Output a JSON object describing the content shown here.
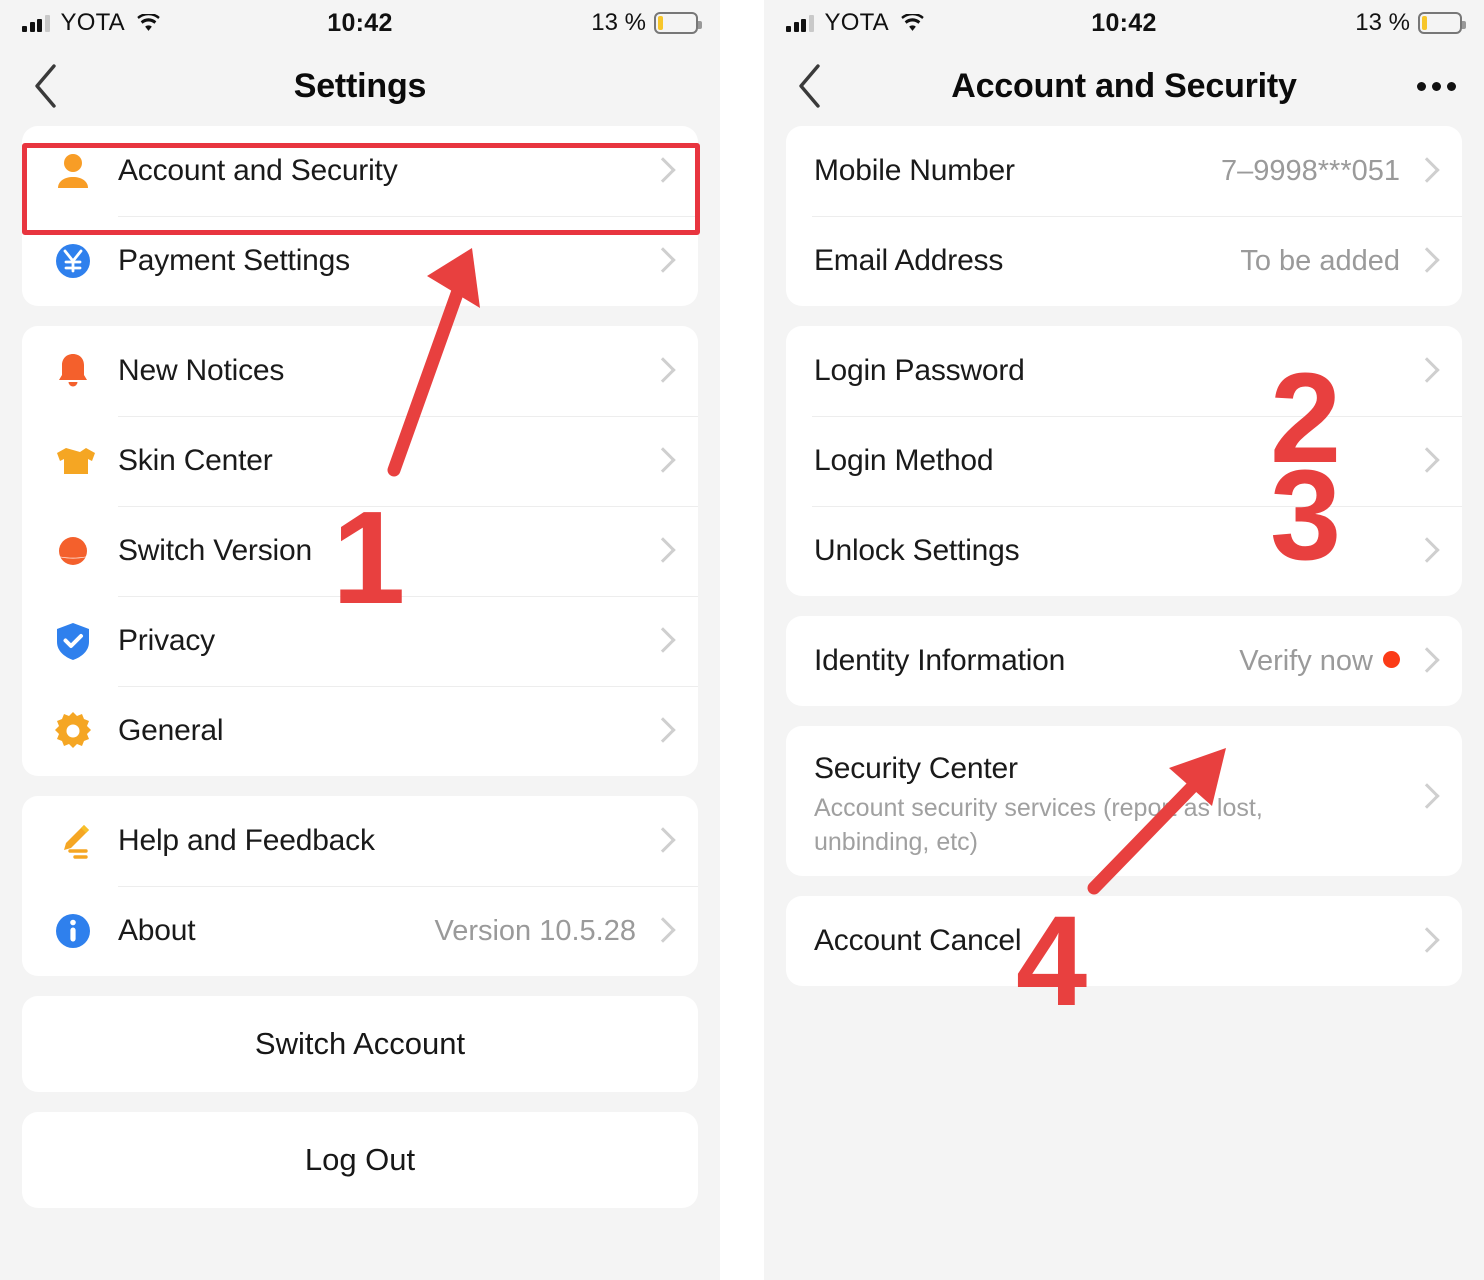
{
  "status_bar": {
    "carrier": "YOTA",
    "time": "10:42",
    "battery_percent": "13 %",
    "battery_level": 13,
    "signal_bars": 4,
    "signal_filled": 3,
    "wifi_icon": "wifi-icon",
    "battery_icon": "battery-icon"
  },
  "left_screen": {
    "nav": {
      "back_icon": "back-chevron-icon",
      "title": "Settings"
    },
    "groups": [
      {
        "items": [
          {
            "icon": "person-icon",
            "label": "Account and Security",
            "value": "",
            "chevron": true
          },
          {
            "icon": "payment-yen-icon",
            "label": "Payment Settings",
            "value": "",
            "chevron": true
          }
        ]
      },
      {
        "items": [
          {
            "icon": "bell-icon",
            "label": "New Notices",
            "value": "",
            "chevron": true
          },
          {
            "icon": "tshirt-icon",
            "label": "Skin Center",
            "value": "",
            "chevron": true
          },
          {
            "icon": "planet-icon",
            "label": "Switch Version",
            "value": "",
            "chevron": true
          },
          {
            "icon": "shield-check-icon",
            "label": "Privacy",
            "value": "",
            "chevron": true
          },
          {
            "icon": "gear-icon",
            "label": "General",
            "value": "",
            "chevron": true
          }
        ]
      },
      {
        "items": [
          {
            "icon": "pencil-icon",
            "label": "Help and Feedback",
            "value": "",
            "chevron": true
          },
          {
            "icon": "info-icon",
            "label": "About",
            "value": "Version 10.5.28",
            "chevron": true
          }
        ]
      }
    ],
    "buttons": [
      {
        "label": "Switch Account"
      },
      {
        "label": "Log Out"
      }
    ]
  },
  "right_screen": {
    "nav": {
      "back_icon": "back-chevron-icon",
      "title": "Account and Security",
      "more_icon": "more-dots-icon"
    },
    "groups": [
      {
        "items": [
          {
            "label": "Mobile Number",
            "value": "7–9998***051",
            "sub": "",
            "dot": false,
            "chevron": true
          },
          {
            "label": "Email Address",
            "value": "To be added",
            "sub": "",
            "dot": false,
            "chevron": true
          }
        ]
      },
      {
        "items": [
          {
            "label": "Login Password",
            "value": "",
            "sub": "",
            "dot": false,
            "chevron": true
          },
          {
            "label": "Login Method",
            "value": "",
            "sub": "",
            "dot": false,
            "chevron": true
          },
          {
            "label": "Unlock Settings",
            "value": "",
            "sub": "",
            "dot": false,
            "chevron": true
          }
        ]
      },
      {
        "items": [
          {
            "label": "Identity Information",
            "value": "Verify now",
            "sub": "",
            "dot": true,
            "chevron": true
          }
        ]
      },
      {
        "items": [
          {
            "label": "Security Center",
            "value": "",
            "sub": "Account security services (report as lost, unbinding, etc)",
            "dot": false,
            "chevron": true
          }
        ]
      },
      {
        "items": [
          {
            "label": "Account Cancel",
            "value": "",
            "sub": "",
            "dot": false,
            "chevron": true
          }
        ]
      }
    ]
  },
  "annotations": {
    "color": "#e8403f",
    "markers": [
      {
        "text": "1"
      },
      {
        "text": "2"
      },
      {
        "text": "3"
      },
      {
        "text": "4"
      }
    ]
  }
}
